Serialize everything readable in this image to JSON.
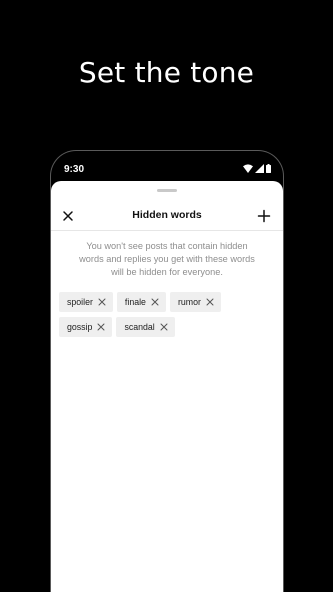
{
  "promo": {
    "headline": "Set the tone"
  },
  "status_bar": {
    "time": "9:30",
    "icons": [
      "wifi-icon",
      "cellular-signal-icon",
      "battery-icon"
    ]
  },
  "sheet": {
    "title": "Hidden words",
    "description": "You won't see posts that contain hidden words and replies you get with these words will be hidden for everyone.",
    "close_icon": "close-icon",
    "add_icon": "plus-icon"
  },
  "hidden_words": [
    {
      "label": "spoiler"
    },
    {
      "label": "finale"
    },
    {
      "label": "rumor"
    },
    {
      "label": "gossip"
    },
    {
      "label": "scandal"
    }
  ],
  "colors": {
    "background": "#000000",
    "sheet": "#ffffff",
    "chip": "#efefef",
    "muted_text": "#8e8e8e"
  }
}
